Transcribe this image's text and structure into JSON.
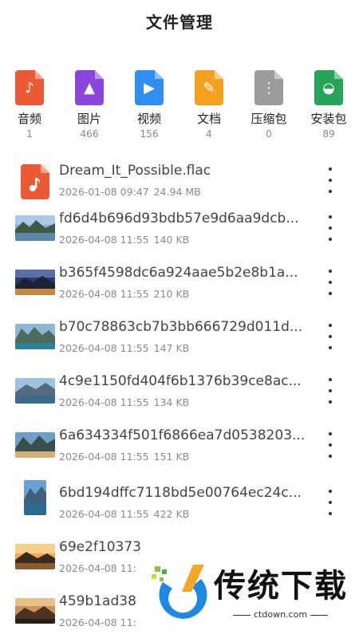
{
  "header": {
    "title": "文件管理"
  },
  "categories": [
    {
      "label": "音频",
      "count": "1",
      "icon": "music-note-icon",
      "color": "#ec5a35",
      "glyph": "♪"
    },
    {
      "label": "图片",
      "count": "466",
      "icon": "image-icon",
      "color": "#8a45de",
      "glyph": "▲"
    },
    {
      "label": "视频",
      "count": "156",
      "icon": "video-play-icon",
      "color": "#2f8ff0",
      "glyph": "▶"
    },
    {
      "label": "文档",
      "count": "4",
      "icon": "document-pen-icon",
      "color": "#f3a21f",
      "glyph": "✎"
    },
    {
      "label": "压缩包",
      "count": "0",
      "icon": "zip-archive-icon",
      "color": "#9b9b9b",
      "glyph": "⋮"
    },
    {
      "label": "安装包",
      "count": "89",
      "icon": "android-apk-icon",
      "color": "#27a35a",
      "glyph": "◒"
    }
  ],
  "files": [
    {
      "name": "Dream_It_Possible.flac",
      "date": "2026-01-08 09:47",
      "size": "24.94 MB",
      "kind": "audio"
    },
    {
      "name": "fd6d4b696d93bdb57e9d6aa9dcb...",
      "date": "2026-04-08 11:55",
      "size": "140 KB",
      "kind": "image"
    },
    {
      "name": "b365f4598dc6a924aae5b2e8b1a...",
      "date": "2026-04-08 11:55",
      "size": "210 KB",
      "kind": "image"
    },
    {
      "name": "b70c78863cb7b3bb666729d011d...",
      "date": "2026-04-08 11:55",
      "size": "147 KB",
      "kind": "image"
    },
    {
      "name": "4c9e1150fd404f6b1376b39ce8ac...",
      "date": "2026-04-08 11:55",
      "size": "134 KB",
      "kind": "image"
    },
    {
      "name": "6a634334f501f6866ea7d0538203...",
      "date": "2026-04-08 11:55",
      "size": "151 KB",
      "kind": "image"
    },
    {
      "name": "6bd194dffc7118bd5e00764ec24c...",
      "date": "2026-04-08 11:55",
      "size": "422 KB",
      "kind": "image-portrait"
    },
    {
      "name": "69e2f10373",
      "date": "2026-04-08 11:",
      "size": "",
      "kind": "image"
    },
    {
      "name": "459b1ad38",
      "date": "2026-04-08 11:",
      "size": "",
      "kind": "image"
    }
  ],
  "watermark": {
    "text": "传统下载",
    "url": "ctdown.com"
  }
}
